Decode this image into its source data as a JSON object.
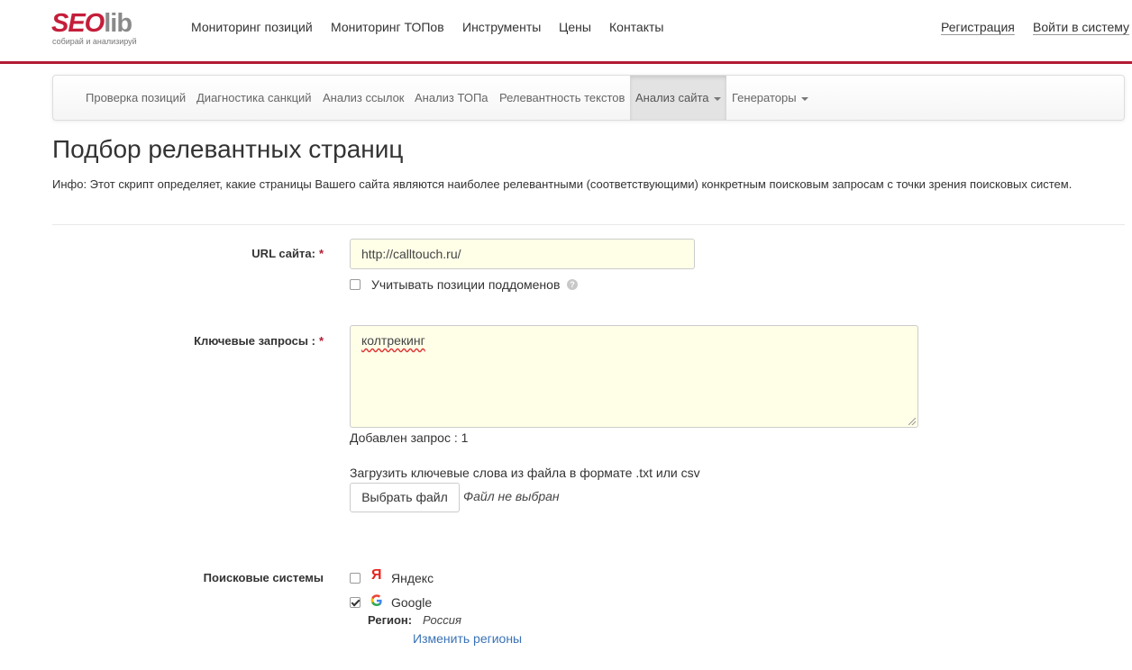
{
  "logo": {
    "part1": "SEO",
    "part2": "lib",
    "tagline": "собирай и анализируй"
  },
  "topnav": {
    "items": [
      "Мониторинг позиций",
      "Мониторинг ТОПов",
      "Инструменты",
      "Цены",
      "Контакты"
    ],
    "register": "Регистрация",
    "login": "Войти в систему"
  },
  "subnav": {
    "items": [
      "Проверка позиций",
      "Диагностика санкций",
      "Анализ ссылок",
      "Анализ ТОПа",
      "Релевантность текстов",
      "Анализ сайта",
      "Генераторы"
    ],
    "active_index": 5
  },
  "page": {
    "title": "Подбор релевантных страниц",
    "info": "Инфо: Этот скрипт определяет, какие страницы Вашего сайта являются наиболее релевантными (соответствующими) конкретным поисковым запросам с точки зрения поисковых систем."
  },
  "form": {
    "url_label": "URL сайта:",
    "required_mark": "*",
    "url_value": "http://calltouch.ru/",
    "subdomains_label": "Учитывать позиции поддоменов",
    "subdomains_checked": false,
    "help_glyph": "?",
    "keywords_label": "Ключевые запросы :",
    "keywords_value": "колтрекинг",
    "added_count": "Добавлен запрос : 1",
    "upload_hint": "Загрузить ключевые слова из файла в формате .txt или csv",
    "file_button": "Выбрать файл",
    "file_status": "Файл не выбран",
    "engines_label": "Поисковые системы",
    "engines": [
      {
        "name": "Яндекс",
        "icon": "yandex-icon",
        "checked": false
      },
      {
        "name": "Google",
        "icon": "google-icon",
        "checked": true
      }
    ],
    "yandex_glyph": "Я",
    "region_label": "Регион:",
    "region_value": "Россия",
    "change_regions": "Изменить регионы"
  },
  "colors": {
    "brand": "#b31b34",
    "link": "#3a72b5",
    "input_bg": "#ffffe8"
  }
}
